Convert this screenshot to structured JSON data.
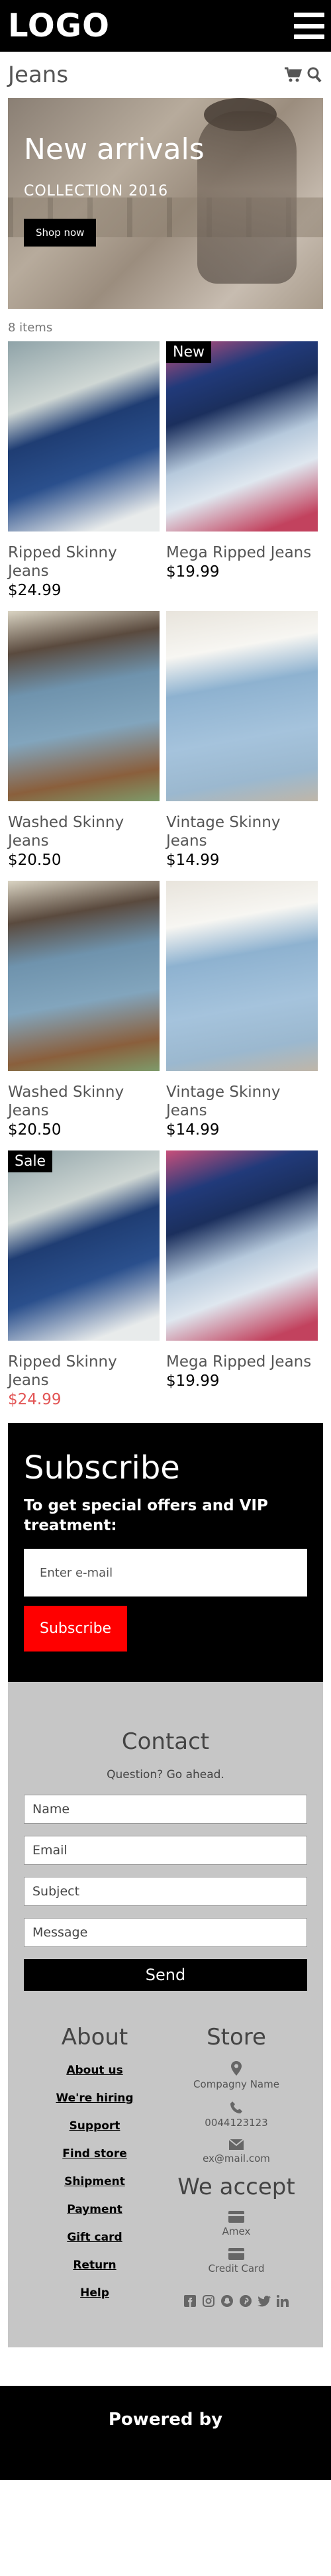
{
  "header": {
    "logo": "LOGO"
  },
  "page": {
    "title": "Jeans",
    "items_count": "8 items"
  },
  "hero": {
    "title": "New arrivals",
    "subtitle": "COLLECTION 2016",
    "button": "Shop now"
  },
  "products": [
    {
      "name": "Ripped Skinny Jeans",
      "price": "$24.99",
      "badge": "",
      "image": "a"
    },
    {
      "name": "Mega Ripped Jeans",
      "price": "$19.99",
      "badge": "New",
      "image": "b"
    },
    {
      "name": "Washed Skinny Jeans",
      "price": "$20.50",
      "badge": "",
      "image": "c"
    },
    {
      "name": "Vintage Skinny Jeans",
      "price": "$14.99",
      "badge": "",
      "image": "d"
    },
    {
      "name": "Washed Skinny Jeans",
      "price": "$20.50",
      "badge": "",
      "image": "c"
    },
    {
      "name": "Vintage Skinny Jeans",
      "price": "$14.99",
      "badge": "",
      "image": "d"
    },
    {
      "name": "Ripped Skinny Jeans",
      "price": "$24.99",
      "badge": "Sale",
      "image": "a",
      "sale": true
    },
    {
      "name": "Mega Ripped Jeans",
      "price": "$19.99",
      "badge": "",
      "image": "b"
    }
  ],
  "subscribe": {
    "title": "Subscribe",
    "text": "To get special offers and VIP treatment:",
    "placeholder": "Enter e-mail",
    "button": "Subscribe"
  },
  "contact": {
    "title": "Contact",
    "subtitle": "Question? Go ahead.",
    "name_placeholder": "Name",
    "email_placeholder": "Email",
    "subject_placeholder": "Subject",
    "message_placeholder": "Message",
    "send": "Send"
  },
  "about": {
    "title": "About",
    "links": [
      "About us",
      "We're hiring",
      "Support",
      "Find store",
      "Shipment",
      "Payment",
      "Gift card",
      "Return",
      "Help"
    ]
  },
  "store": {
    "title": "Store",
    "company": "Compagny Name",
    "phone": "0044123123",
    "email": "ex@mail.com"
  },
  "accept": {
    "title": "We accept",
    "methods": [
      "Amex",
      "Credit Card"
    ]
  },
  "socials": [
    "facebook-icon",
    "instagram-icon",
    "snapchat-icon",
    "pinterest-icon",
    "twitter-icon",
    "linkedin-icon"
  ],
  "footer": {
    "powered_by": "Powered by"
  },
  "colors": {
    "sale_price": "#e25555",
    "subscribe_button": "#ff0000",
    "footer_gray": "#c6c6c6"
  }
}
